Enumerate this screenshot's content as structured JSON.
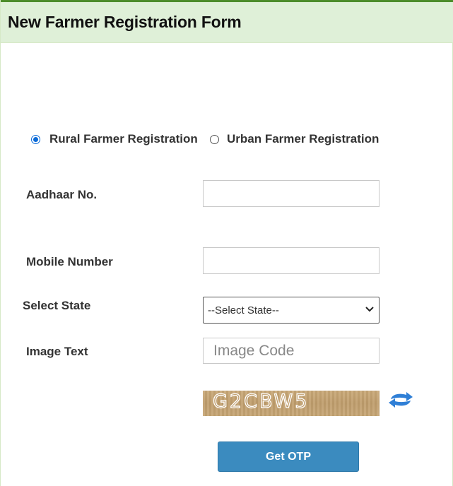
{
  "header": {
    "title": "New Farmer Registration Form"
  },
  "registration_type": {
    "options": [
      {
        "label": "Rural Farmer Registration",
        "checked": true
      },
      {
        "label": "Urban Farmer Registration",
        "checked": false
      }
    ]
  },
  "fields": {
    "aadhaar": {
      "label": "Aadhaar No.",
      "value": ""
    },
    "mobile": {
      "label": "Mobile Number",
      "value": ""
    },
    "state": {
      "label": "Select State",
      "selected": "--Select State--"
    },
    "image_text": {
      "label": "Image Text",
      "placeholder": "Image Code",
      "value": ""
    }
  },
  "captcha": {
    "text": "G2CBW5",
    "refresh_icon": "refresh-icon"
  },
  "submit": {
    "label": "Get OTP"
  },
  "colors": {
    "header_bg": "#dff0d8",
    "header_border": "#4c8c2b",
    "accent_radio": "#0a6ad8",
    "button_bg": "#3b8bbf",
    "refresh_icon": "#2f7fd6"
  }
}
